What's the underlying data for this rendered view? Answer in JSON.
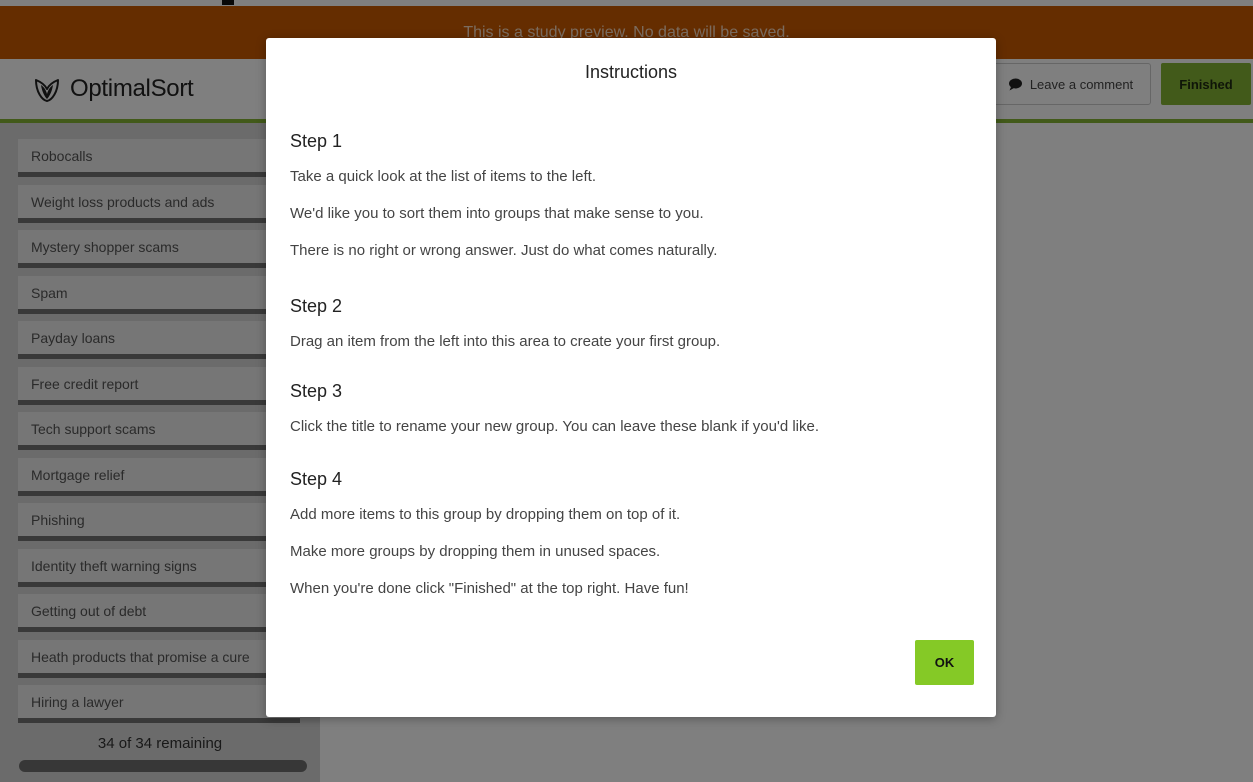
{
  "banner": {
    "text": "This is a study preview. No data will be saved."
  },
  "header": {
    "logo_text": "OptimalSort",
    "comment_label": "Leave a comment",
    "finished_label": "Finished"
  },
  "sidebar": {
    "cards": [
      "Robocalls",
      "Weight loss products and ads",
      "Mystery shopper scams",
      "Spam",
      "Payday loans",
      "Free credit report",
      "Tech support scams",
      "Mortgage relief",
      "Phishing",
      "Identity theft warning signs",
      "Getting out of debt",
      "Heath products that promise a cure",
      "Hiring a lawyer"
    ],
    "remaining_text": "34 of 34 remaining",
    "remaining_fraction": 1.0
  },
  "modal": {
    "title": "Instructions",
    "steps": [
      {
        "heading": "Step 1",
        "lines": [
          "Take a quick look at the list of items to the left.",
          "We'd like you to sort them into groups that make sense to you.",
          "There is no right or wrong answer. Just do what comes naturally."
        ]
      },
      {
        "heading": "Step 2",
        "lines": [
          "Drag an item from the left into this area to create your first group."
        ]
      },
      {
        "heading": "Step 3",
        "lines": [
          "Click the title to rename your new group. You can leave these blank if you'd like."
        ]
      },
      {
        "heading": "Step 4",
        "lines": [
          "Add more items to this group by dropping them on top of it.",
          "Make more groups by dropping them in unused spaces.",
          "When you're done click \"Finished\" at the top right. Have fun!"
        ]
      }
    ],
    "ok_label": "OK"
  },
  "colors": {
    "banner": "#ca5a00",
    "accent_green": "#85b535",
    "ok_green": "#85c926"
  }
}
